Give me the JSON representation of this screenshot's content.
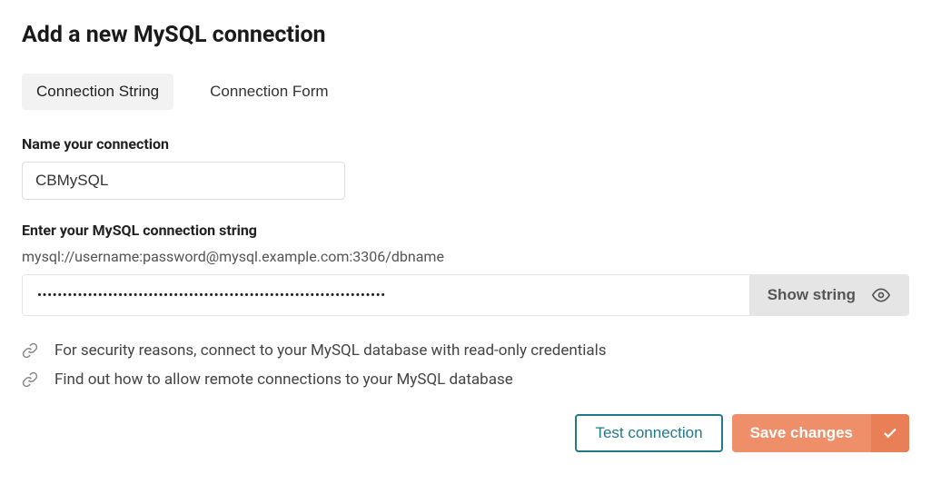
{
  "title": "Add a new MySQL connection",
  "tabs": {
    "connection_string": "Connection String",
    "connection_form": "Connection Form"
  },
  "name_field": {
    "label": "Name your connection",
    "value": "CBMySQL"
  },
  "connection_string_field": {
    "label": "Enter your MySQL connection string",
    "hint": "mysql://username:password@mysql.example.com:3306/dbname",
    "masked_value": "•••••••••••••••••••••••••••••••••••••••••••••••••••••••••••••••••••••",
    "show_button": "Show string"
  },
  "help_links": {
    "read_only": "For security reasons, connect to your MySQL database with read-only credentials",
    "remote": "Find out how to allow remote connections to your MySQL database"
  },
  "actions": {
    "test": "Test connection",
    "save": "Save changes"
  }
}
